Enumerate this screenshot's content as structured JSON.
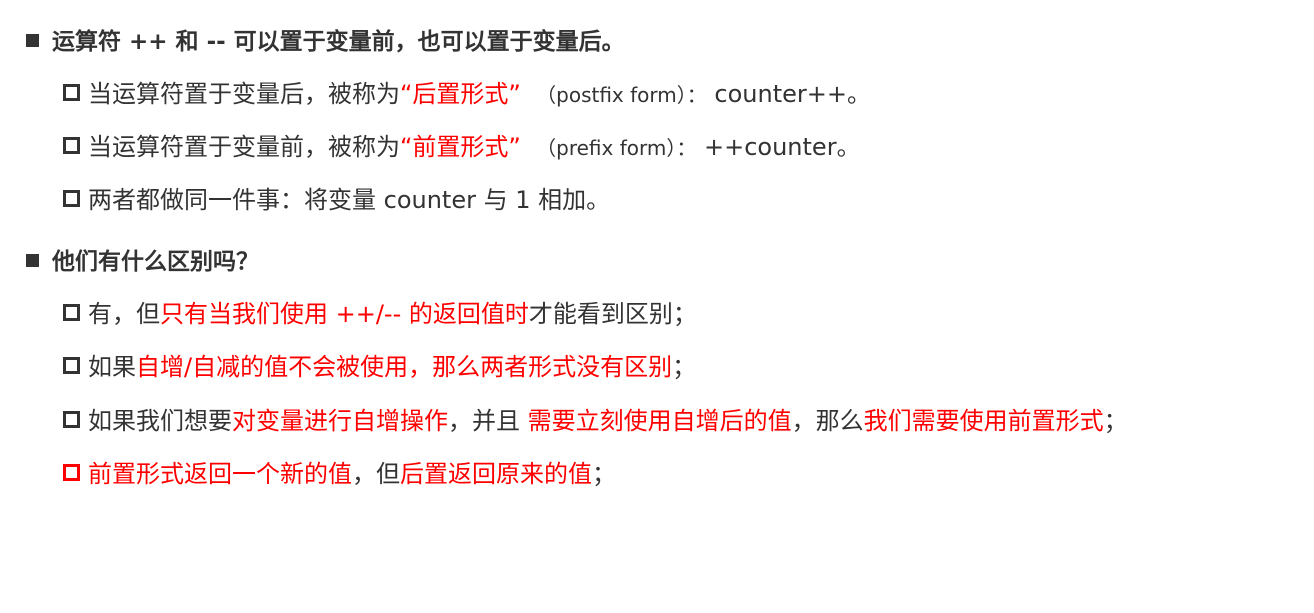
{
  "section1": {
    "heading": "运算符 ++ 和 -- 可以置于变量前，也可以置于变量后。",
    "items": [
      {
        "pre": "当运算符置于变量后，被称为",
        "term": "“后置形式”",
        "note": "（postfix form）：",
        "code": "counter++。"
      },
      {
        "pre": "当运算符置于变量前，被称为",
        "term": "“前置形式”",
        "note": "（prefix form）：",
        "code": "++counter。"
      },
      {
        "text": "两者都做同一件事：将变量 counter 与 1 相加。"
      }
    ]
  },
  "section2": {
    "heading": "他们有什么区别吗？",
    "item1": {
      "a": "有，但",
      "b": "只有当我们使用 ++/-- 的返回值时",
      "c": "才能看到区别；"
    },
    "item2": {
      "a": "如果",
      "b": "自增/自减的值不会被使用，那么两者形式没有区别",
      "c": "；"
    },
    "item3": {
      "a": "如果我们想要",
      "b": "对变量进行自增操作",
      "c": "，并且 ",
      "d": "需要立刻使用自增后的值",
      "e": "，那么",
      "f": "我们需要使用前置形式",
      "g": "；"
    },
    "item4": {
      "a": "前置形式返回一个新的值",
      "b": "，但",
      "c": "后置返回原来的值",
      "d": "；"
    }
  },
  "colors": {
    "text": "#333333",
    "highlight": "#ff0000"
  }
}
